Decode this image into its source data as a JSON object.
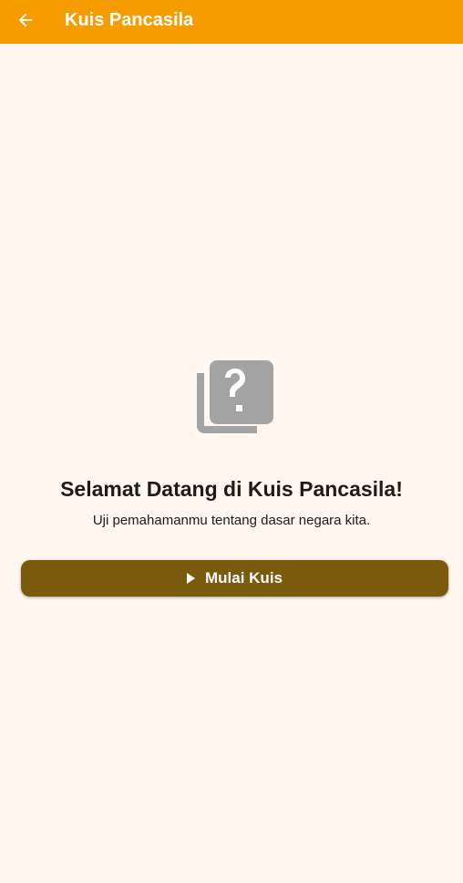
{
  "app_bar": {
    "title": "Kuis Pancasila",
    "back_icon": "arrow-back-icon",
    "background_color": "#f59c00"
  },
  "main": {
    "icon": "quiz-question-icon",
    "title": "Selamat Datang di Kuis Pancasila!",
    "subtitle": "Uji pemahamanmu tentang dasar negara kita.",
    "start_button": {
      "label": "Mulai Kuis",
      "icon": "play-icon",
      "background_color": "#7a5a0c"
    }
  },
  "colors": {
    "page_background": "#fff7f0",
    "icon_gray": "#a3a3a3",
    "text_dark": "#1f1b16"
  }
}
